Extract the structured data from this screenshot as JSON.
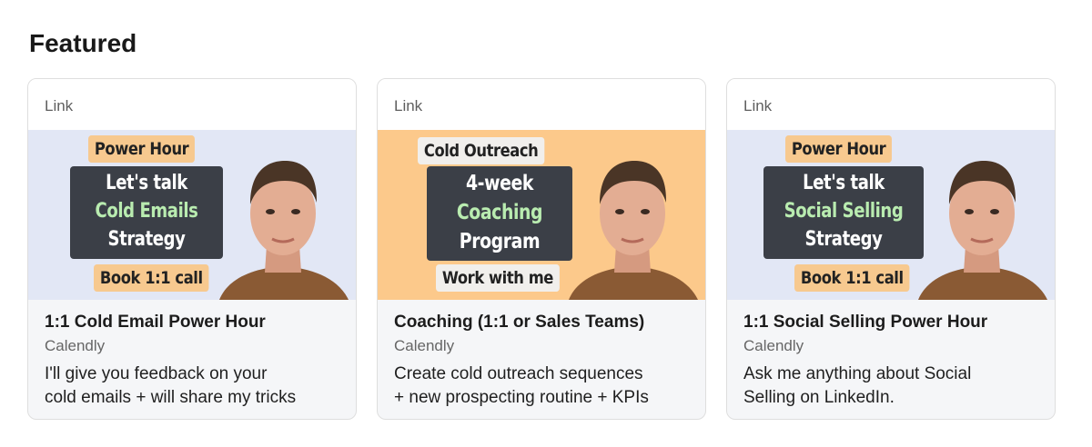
{
  "section": {
    "title": "Featured"
  },
  "cards": [
    {
      "type": "Link",
      "thumbnail": {
        "background": "#e2e7f5",
        "top_tag": "Power Hour",
        "board_lines": [
          "Let's talk",
          "Cold Emails",
          "Strategy"
        ],
        "bottom_tag": "Book 1:1 call"
      },
      "title": "1:1 Cold Email Power Hour",
      "source": "Calendly",
      "description_lines": [
        "I'll give you feedback on your",
        "cold emails + will share my tricks"
      ]
    },
    {
      "type": "Link",
      "thumbnail": {
        "background": "#fcc98b",
        "top_tag": "Cold Outreach",
        "board_lines": [
          "4-week",
          "Coaching",
          "Program"
        ],
        "bottom_tag": "Work with me"
      },
      "title": "Coaching (1:1 or Sales Teams)",
      "source": "Calendly",
      "description_lines": [
        "Create cold outreach sequences",
        "+ new prospecting routine + KPIs"
      ]
    },
    {
      "type": "Link",
      "thumbnail": {
        "background": "#e2e7f5",
        "top_tag": "Power Hour",
        "board_lines": [
          "Let's talk",
          "Social Selling",
          "Strategy"
        ],
        "bottom_tag": "Book 1:1 call"
      },
      "title": "1:1 Social Selling Power Hour",
      "source": "Calendly",
      "description_lines": [
        "Ask me anything about Social",
        "Selling on LinkedIn."
      ]
    }
  ]
}
